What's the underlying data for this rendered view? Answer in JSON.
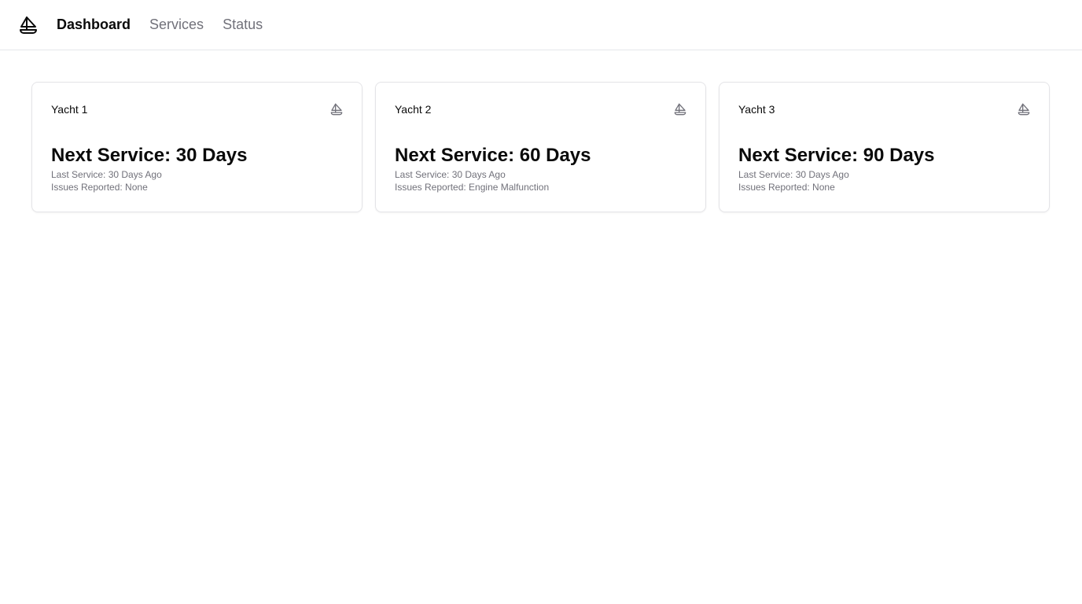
{
  "nav": {
    "logo_icon": "sailboat-icon",
    "items": [
      {
        "label": "Dashboard",
        "active": true
      },
      {
        "label": "Services",
        "active": false
      },
      {
        "label": "Status",
        "active": false
      }
    ]
  },
  "cards": [
    {
      "title": "Yacht 1",
      "icon": "sailboat-icon",
      "next_service": "Next Service: 30 Days",
      "last_service": "Last Service: 30 Days Ago",
      "issues": "Issues Reported: None"
    },
    {
      "title": "Yacht 2",
      "icon": "sailboat-icon",
      "next_service": "Next Service: 60 Days",
      "last_service": "Last Service: 30 Days Ago",
      "issues": "Issues Reported: Engine Malfunction"
    },
    {
      "title": "Yacht 3",
      "icon": "sailboat-icon",
      "next_service": "Next Service: 90 Days",
      "last_service": "Last Service: 30 Days Ago",
      "issues": "Issues Reported: None"
    }
  ],
  "colors": {
    "text": "#0a0a0a",
    "muted": "#71717a",
    "border": "#e4e4e7"
  }
}
